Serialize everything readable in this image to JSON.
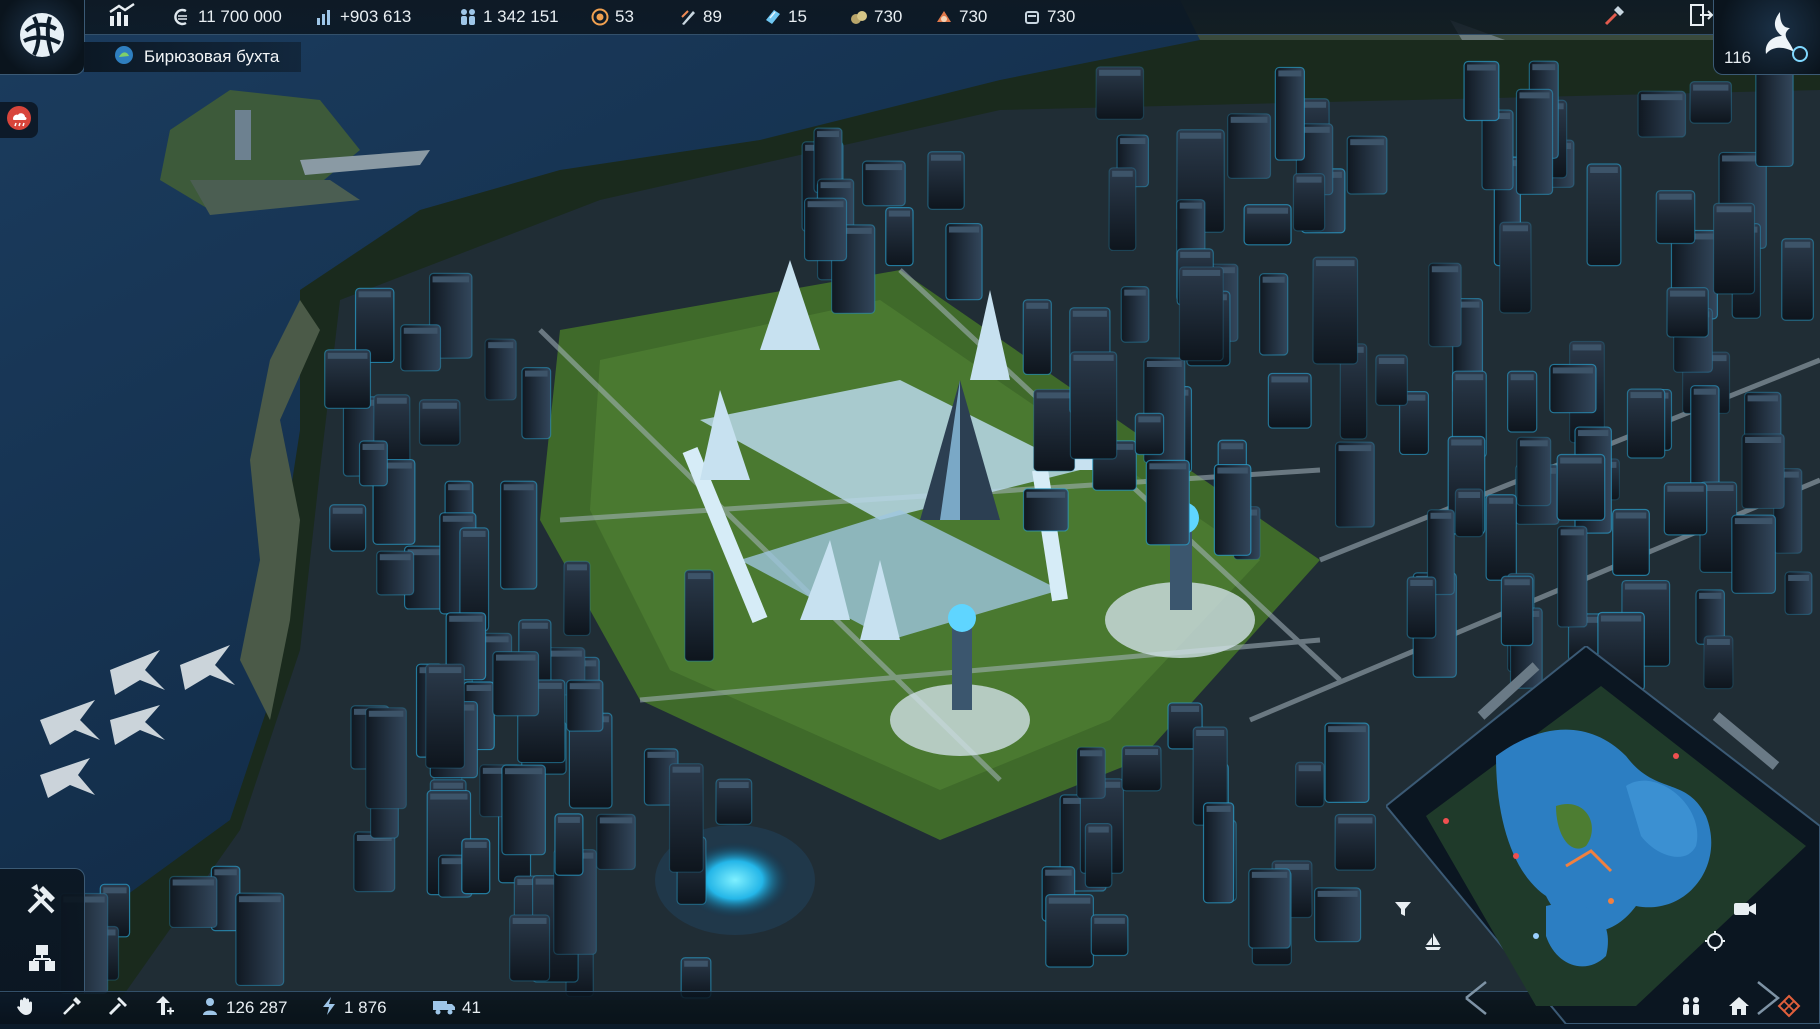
{
  "topbar": {
    "menu_icon": "globe-menu-icon",
    "statistics_icon": "statistics-chart-icon",
    "resources": [
      {
        "name": "credits",
        "icon": "credits-icon",
        "value": "11 700 000"
      },
      {
        "name": "balance",
        "icon": "balance-bars-icon",
        "value": "+903 613"
      },
      {
        "name": "population",
        "icon": "population-icon",
        "value": "1 342 151"
      },
      {
        "name": "influence",
        "icon": "influence-icon",
        "value": "53"
      },
      {
        "name": "research",
        "icon": "research-icon",
        "value": "89"
      },
      {
        "name": "licenses",
        "icon": "license-icon",
        "value": "15"
      },
      {
        "name": "goods-1",
        "icon": "goods-icon",
        "value": "730"
      },
      {
        "name": "goods-2",
        "icon": "goods-icon",
        "value": "730"
      },
      {
        "name": "goods-3",
        "icon": "goods-icon",
        "value": "730"
      }
    ],
    "island_name": "Бирюзовая бухта",
    "corner_value": "116"
  },
  "bottombar": {
    "tools": [
      "grab-hand-icon",
      "pipette-icon",
      "hammer-icon",
      "upgrade-arrow-icon"
    ],
    "resources": [
      {
        "name": "workforce",
        "icon": "worker-icon",
        "value": "126 287"
      },
      {
        "name": "energy",
        "icon": "energy-bolt-icon",
        "value": "1 876"
      },
      {
        "name": "transport",
        "icon": "truck-icon",
        "value": "41"
      }
    ]
  },
  "colors": {
    "accent": "#39c8ff",
    "panel": "#0b1621",
    "border": "#3b5a75",
    "water": "#143253",
    "grass": "#4f7a2e"
  }
}
